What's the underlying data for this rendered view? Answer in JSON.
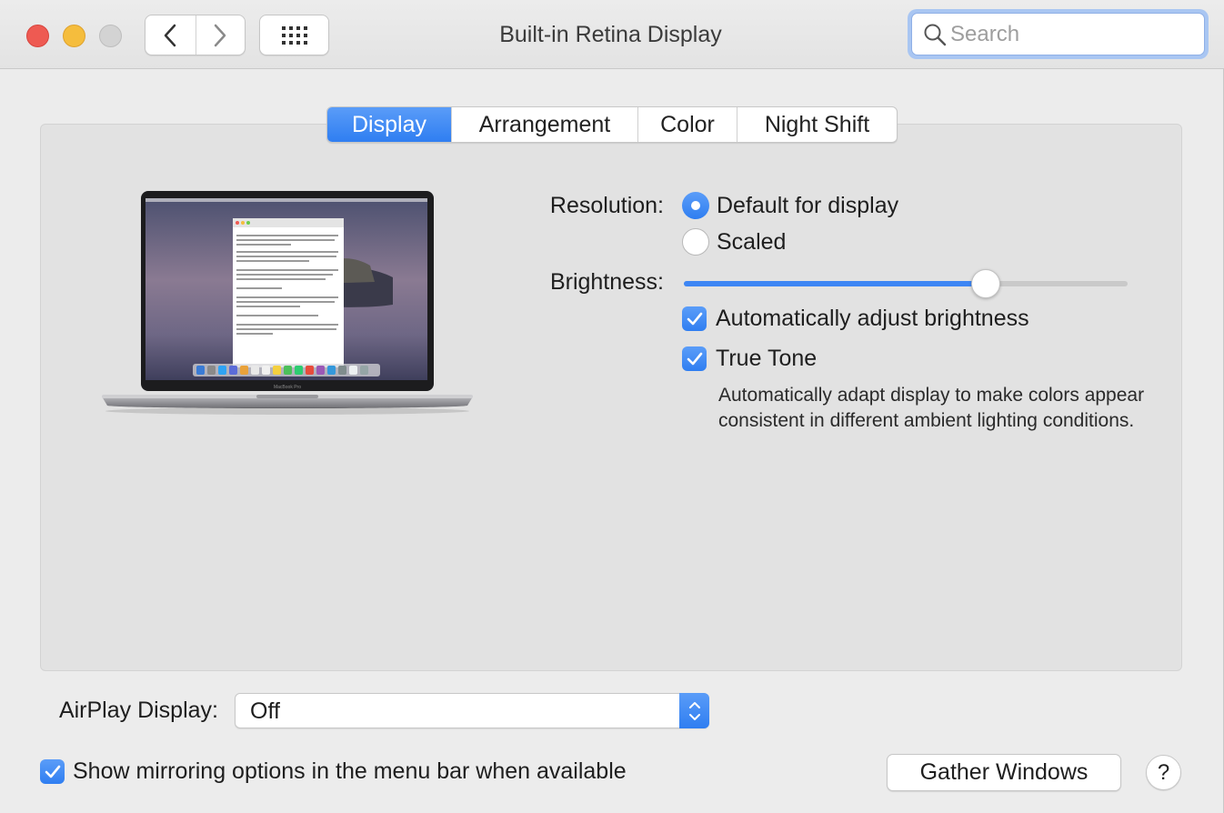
{
  "window": {
    "title": "Built-in Retina Display"
  },
  "search": {
    "placeholder": "Search",
    "value": ""
  },
  "tabs": [
    {
      "label": "Display",
      "active": true
    },
    {
      "label": "Arrangement",
      "active": false
    },
    {
      "label": "Color",
      "active": false
    },
    {
      "label": "Night Shift",
      "active": false
    }
  ],
  "display": {
    "resolution_label": "Resolution:",
    "resolution_options": [
      {
        "label": "Default for display",
        "selected": true
      },
      {
        "label": "Scaled",
        "selected": false
      }
    ],
    "brightness_label": "Brightness:",
    "brightness_level": 0.68,
    "auto_brightness_label": "Automatically adjust brightness",
    "auto_brightness_checked": true,
    "true_tone_label": "True Tone",
    "true_tone_checked": true,
    "true_tone_description": "Automatically adapt display to make colors appear consistent in different ambient lighting conditions.",
    "laptop_caption": "MacBook Pro"
  },
  "airplay": {
    "label": "AirPlay Display:",
    "value": "Off"
  },
  "mirroring": {
    "label": "Show mirroring options in the menu bar when available",
    "checked": true
  },
  "buttons": {
    "gather_windows": "Gather Windows",
    "help": "?"
  },
  "colors": {
    "accent": "#2f7ef1",
    "close": "#ee5a52",
    "minimize": "#f5bd3d"
  }
}
